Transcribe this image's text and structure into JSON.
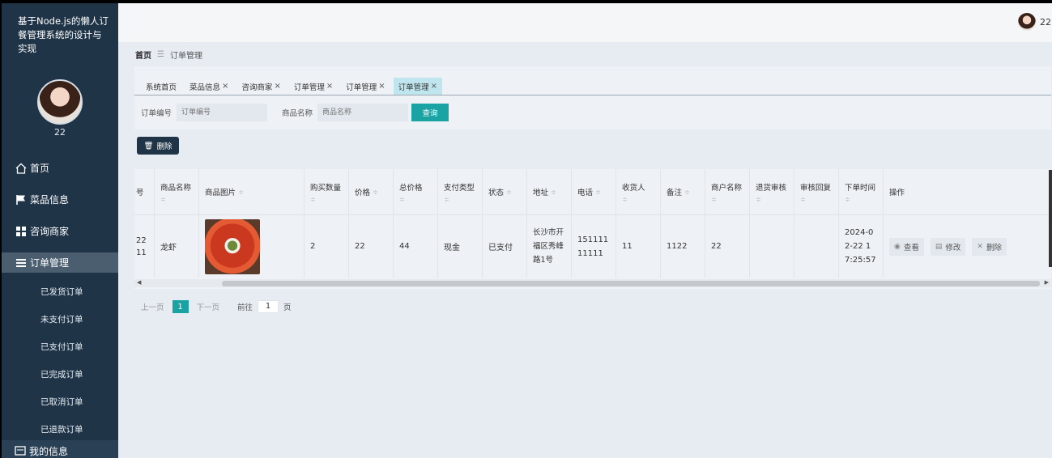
{
  "app": {
    "title": "基于Node.js的懒人订餐管理系统的设计与实现",
    "username": "22"
  },
  "sidebar": {
    "items": [
      {
        "label": "首页",
        "icon": "home-icon"
      },
      {
        "label": "菜品信息",
        "icon": "flag-icon"
      },
      {
        "label": "咨询商家",
        "icon": "grid-icon"
      },
      {
        "label": "订单管理",
        "icon": "list-icon"
      }
    ],
    "submenu": [
      "已发货订单",
      "未支付订单",
      "已支付订单",
      "已完成订单",
      "已取消订单",
      "已退款订单"
    ],
    "bottom_label": "我的信息"
  },
  "breadcrumb": {
    "home": "首页",
    "current": "订单管理"
  },
  "tabs": [
    {
      "label": "系统首页",
      "closable": false
    },
    {
      "label": "菜品信息",
      "closable": true
    },
    {
      "label": "咨询商家",
      "closable": true
    },
    {
      "label": "订单管理",
      "closable": true
    },
    {
      "label": "订单管理",
      "closable": true
    },
    {
      "label": "订单管理",
      "closable": true,
      "active": true
    }
  ],
  "search": {
    "order_no_label": "订单编号",
    "order_no_placeholder": "订单编号",
    "product_name_label": "商品名称",
    "product_name_placeholder": "商品名称",
    "query_label": "查询"
  },
  "toolbar": {
    "delete_label": "删除"
  },
  "table": {
    "headers": {
      "order_no": "号",
      "product_name": "商品名称",
      "product_image": "商品图片",
      "quantity": "购买数量",
      "price": "价格",
      "total": "总价格",
      "pay_type": "支付类型",
      "status": "状态",
      "address": "地址",
      "phone": "电话",
      "receiver": "收货人",
      "remark": "备注",
      "merchant": "商户名称",
      "refund_review": "退货审核",
      "review_reply": "审核回复",
      "order_time": "下单时间",
      "actions": "操作"
    },
    "rows": [
      {
        "order_no": "22\n11",
        "product_name": "龙虾",
        "quantity": "2",
        "price": "22",
        "total": "44",
        "pay_type": "现金",
        "status": "已支付",
        "address": "长沙市开福区秀峰路1号",
        "phone": "15111111111",
        "receiver": "11",
        "remark": "1122",
        "merchant": "22",
        "refund_review": "",
        "review_reply": "",
        "order_time": "2024-02-22 17:25:57"
      }
    ],
    "actions": {
      "view": "查看",
      "edit": "修改",
      "delete": "删除"
    }
  },
  "pager": {
    "prev": "上一页",
    "current": "1",
    "next": "下一页",
    "goto_label": "前往",
    "goto_value": "1",
    "page_label": "页"
  },
  "colors": {
    "sidebar_bg": "#1f3447",
    "accent": "#1aa3a3",
    "active_tab": "#bfe6ee"
  }
}
